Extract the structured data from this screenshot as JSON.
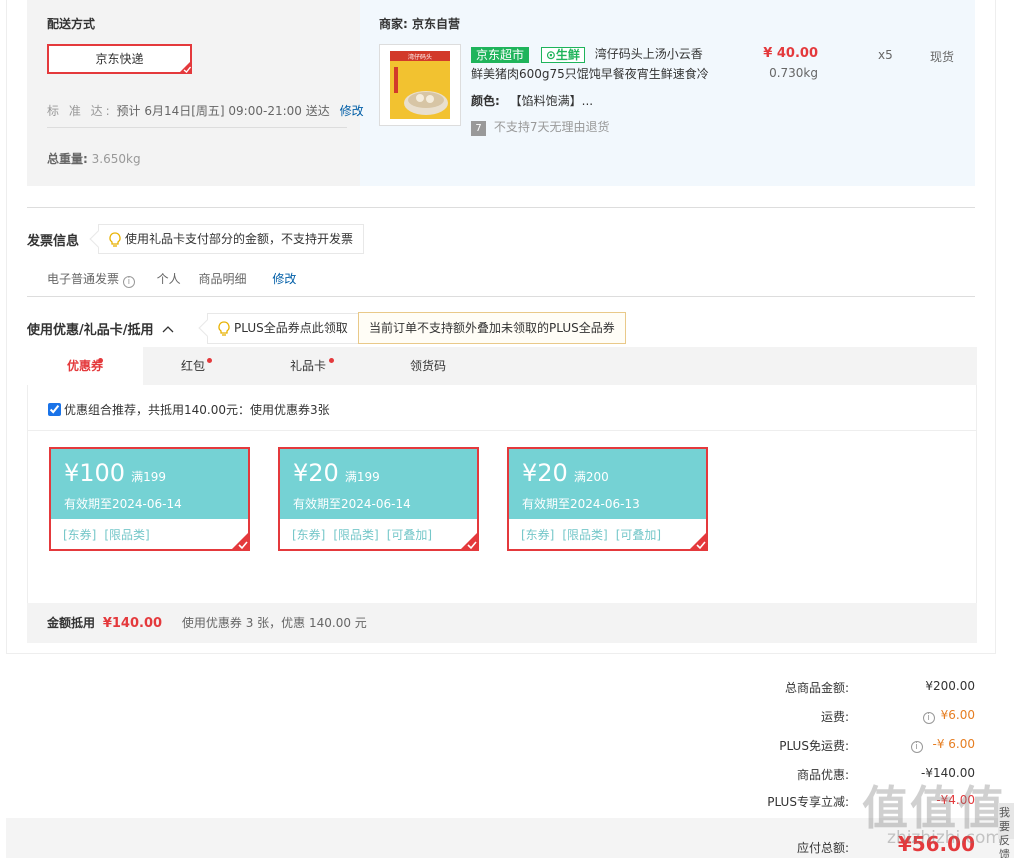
{
  "shipping": {
    "title": "配送方式",
    "option": "京东快递",
    "std_label": "标 准 达:",
    "std_text": "预计 6月14日[周五] 09:00-21:00 送达",
    "modify": "修改",
    "weight_label": "总重量:",
    "weight_value": "3.650kg"
  },
  "merchant": {
    "title": "商家: 京东自营",
    "tag_supermarket": "京东超市",
    "tag_fresh": "生鲜",
    "product_title_1": "湾仔码头上汤小云香",
    "product_title_2": "鲜美猪肉600g75只馄饨早餐夜宵生鲜速食冷",
    "color_label": "颜色:",
    "color_value": "【馅料饱满】...",
    "return_badge": "7",
    "return_text": "不支持7天无理由退货",
    "price": "¥ 40.00",
    "weight": "0.730kg",
    "qty": "x5",
    "stock": "现货",
    "thumb_brand": "湾仔码头"
  },
  "invoice": {
    "title": "发票信息",
    "tip": "使用礼品卡支付部分的金额，不支持开发票",
    "type": "电子普通发票",
    "info_icon": "i",
    "person": "个人",
    "detail": "商品明细",
    "modify": "修改"
  },
  "promo": {
    "title": "使用优惠/礼品卡/抵用",
    "tip": "PLUS全品券点此领取",
    "notice": "当前订单不支持额外叠加未领取的PLUS全品券",
    "tabs": [
      "优惠券",
      "红包",
      "礼品卡",
      "领货码"
    ],
    "combo_text": "优惠组合推荐，共抵用140.00元：使用优惠券3张",
    "coupons": [
      {
        "amount": "¥100",
        "cond": "满199",
        "valid": "有效期至2024-06-14",
        "tags": [
          "[东券]",
          "[限品类]"
        ]
      },
      {
        "amount": "¥20",
        "cond": "满199",
        "valid": "有效期至2024-06-14",
        "tags": [
          "[东券]",
          "[限品类]",
          "[可叠加]"
        ]
      },
      {
        "amount": "¥20",
        "cond": "满200",
        "valid": "有效期至2024-06-13",
        "tags": [
          "[东券]",
          "[限品类]",
          "[可叠加]"
        ]
      }
    ],
    "discount_label": "金额抵用",
    "discount_value": "¥140.00",
    "discount_desc": "使用优惠券 3 张，优惠 140.00 元"
  },
  "summary": {
    "goods_label": "总商品金额:",
    "goods_value": "¥200.00",
    "freight_label": "运费:",
    "freight_value": "¥6.00",
    "plus_free_label": "PLUS免运费:",
    "plus_free_value": "-¥ 6.00",
    "discount_label": "商品优惠:",
    "discount_value": "-¥140.00",
    "plus_label": "PLUS专享立减:",
    "plus_value": "-¥4.00",
    "total_label": "应付总额:",
    "total_value": "¥56.00"
  },
  "watermark": {
    "main": "值值值",
    "sub": "zhizhizhi.com",
    "side": "我要反馈"
  },
  "colors": {
    "accent": "#e4393c",
    "coupon_bg": "#75d2d4",
    "jd_green": "#1fb45b",
    "link": "#005ea7"
  }
}
